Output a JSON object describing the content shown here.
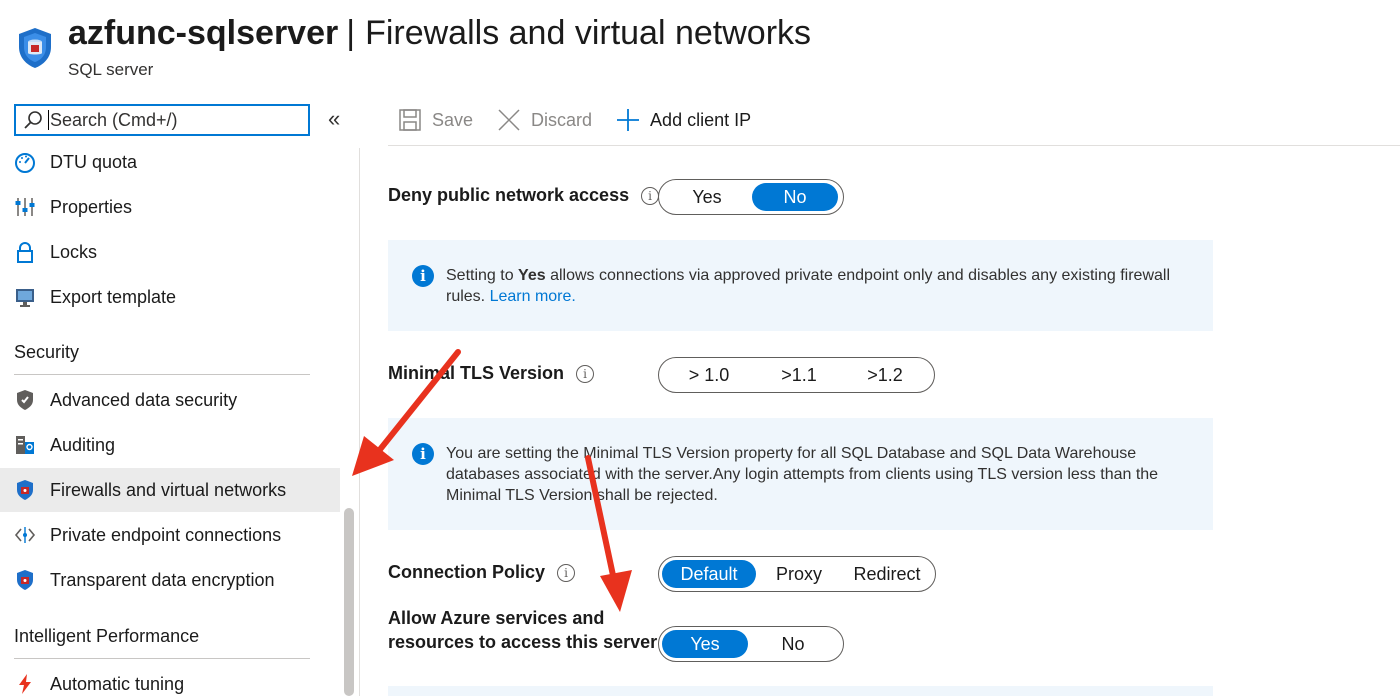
{
  "header": {
    "resource_name": "azfunc-sqlserver",
    "separator": "|",
    "page_title": "Firewalls and virtual networks",
    "resource_type": "SQL server",
    "icon": "sql-server-shield-icon"
  },
  "sidebar": {
    "search_placeholder": "Search (Cmd+/)",
    "collapse_label": "«",
    "items_top": [
      {
        "label": "DTU quota",
        "icon": "gauge-icon"
      },
      {
        "label": "Properties",
        "icon": "properties-icon"
      },
      {
        "label": "Locks",
        "icon": "lock-icon"
      },
      {
        "label": "Export template",
        "icon": "export-template-icon"
      }
    ],
    "section_security": "Security",
    "items_security": [
      {
        "label": "Advanced data security",
        "icon": "shield-icon"
      },
      {
        "label": "Auditing",
        "icon": "auditing-icon"
      },
      {
        "label": "Firewalls and virtual networks",
        "icon": "firewall-shield-icon",
        "active": true
      },
      {
        "label": "Private endpoint connections",
        "icon": "endpoint-icon"
      },
      {
        "label": "Transparent data encryption",
        "icon": "encryption-shield-icon"
      }
    ],
    "section_performance": "Intelligent Performance",
    "items_performance": [
      {
        "label": "Automatic tuning",
        "icon": "lightning-icon"
      }
    ]
  },
  "toolbar": {
    "save_label": "Save",
    "discard_label": "Discard",
    "add_client_ip_label": "Add client IP"
  },
  "form": {
    "deny_public": {
      "label": "Deny public network access",
      "options": [
        "Yes",
        "No"
      ],
      "selected": "No"
    },
    "deny_info": {
      "prefix": "Setting to ",
      "bold": "Yes",
      "suffix": " allows connections via approved private endpoint only and disables any existing firewall rules. ",
      "link": "Learn more."
    },
    "tls": {
      "label": "Minimal TLS Version",
      "options": [
        "> 1.0",
        ">1.1",
        ">1.2"
      ],
      "selected": null
    },
    "tls_info": "You are setting the Minimal TLS Version property for all SQL Database and SQL Data Warehouse databases associated with the server.Any login attempts from clients using TLS version less than the Minimal TLS Version shall be rejected.",
    "connection_policy": {
      "label": "Connection Policy",
      "options": [
        "Default",
        "Proxy",
        "Redirect"
      ],
      "selected": "Default"
    },
    "allow_azure": {
      "label_line1": "Allow Azure services and",
      "label_line2": "resources to access this server",
      "options": [
        "Yes",
        "No"
      ],
      "selected": "Yes"
    }
  },
  "colors": {
    "accent": "#0078d4",
    "info_bg": "#eff6fc",
    "annotation_arrow": "#e8321e",
    "active_nav_bg": "#ebebeb"
  }
}
